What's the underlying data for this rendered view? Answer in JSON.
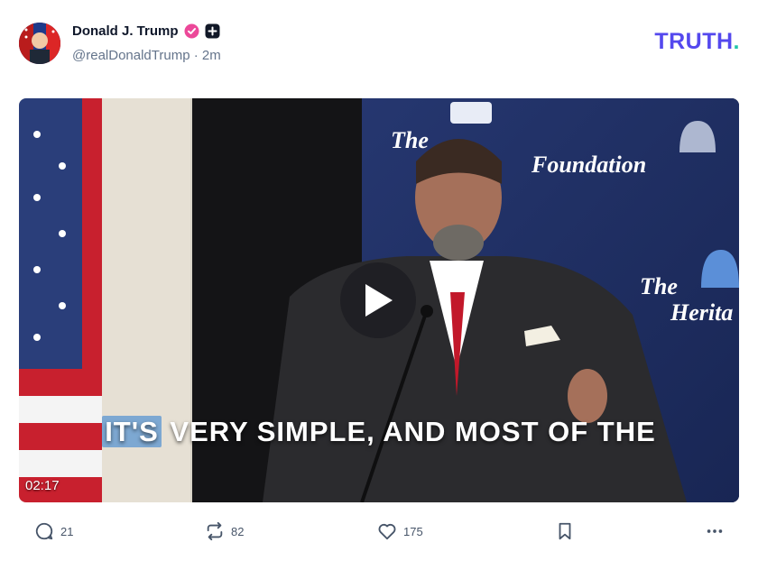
{
  "post": {
    "author_name": "Donald J. Trump",
    "handle": "@realDonaldTrump",
    "separator": "·",
    "time_ago": "2m"
  },
  "brand": {
    "logo_text": "TRUTH",
    "logo_dot": ".",
    "logo_color": "#5448ee",
    "logo_dot_color": "#21c5a9"
  },
  "video": {
    "caption_highlight": "IT'S",
    "caption_rest": " VERY SIMPLE, AND MOST OF THE",
    "duration": "02:17",
    "banner_text_1": "The",
    "banner_text_2": "Foundation",
    "banner_text_3": "The",
    "banner_text_4": "Herita"
  },
  "actions": {
    "replies": "21",
    "retruths": "82",
    "likes": "175"
  },
  "icons": {
    "verified": "verified-badge-icon",
    "plus": "truth-plus-icon",
    "reply": "comment-icon",
    "retruth": "retruth-icon",
    "like": "heart-icon",
    "bookmark": "bookmark-icon",
    "more": "more-icon",
    "play": "play-icon"
  }
}
